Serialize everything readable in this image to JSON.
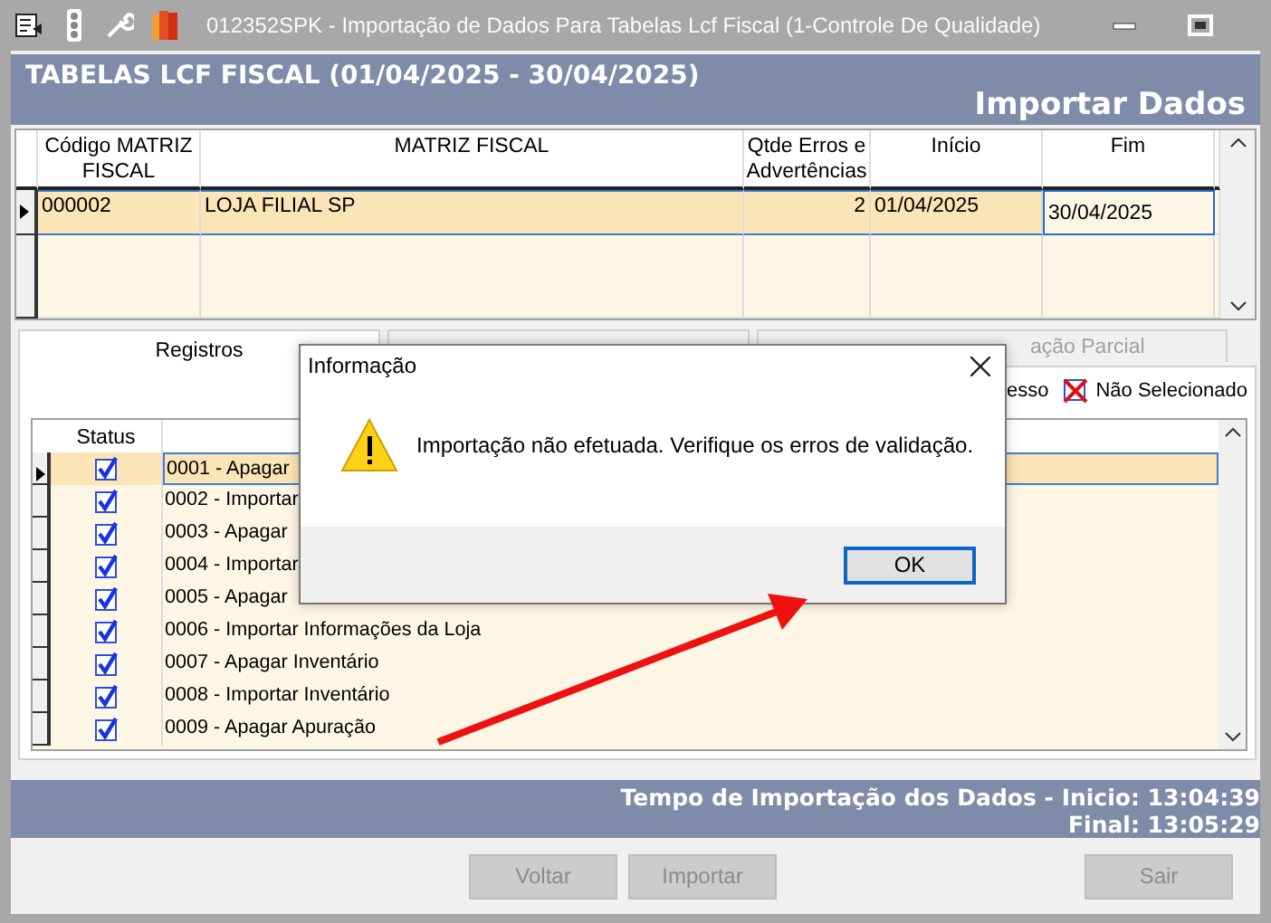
{
  "window": {
    "title": "012352SPK - Importação de Dados Para Tabelas Lcf Fiscal (1-Controle De Qualidade)"
  },
  "header": {
    "title": "TABELAS LCF FISCAL (01/04/2025 - 30/04/2025)",
    "subtitle": "Importar Dados"
  },
  "matrix_table": {
    "columns": [
      "Código MATRIZ FISCAL",
      "MATRIZ FISCAL",
      "Qtde Erros e Advertências",
      "Início",
      "Fim"
    ],
    "rows": [
      {
        "cells": [
          "000002",
          "LOJA FILIAL SP",
          "2",
          "01/04/2025",
          "30/04/2025"
        ],
        "selected": true
      }
    ]
  },
  "tabs": [
    {
      "label": "Registros",
      "selected": true
    },
    {
      "selected": false
    },
    {
      "label": "ação Parcial",
      "selected": false
    }
  ],
  "legend": [
    {
      "kind": "text",
      "label": "esso"
    },
    {
      "kind": "unselected",
      "label": "Não Selecionado"
    }
  ],
  "steps_table": {
    "columns": [
      "Status"
    ],
    "rows": [
      {
        "label": "0001 - Apagar",
        "checked": true,
        "selected": true
      },
      {
        "label": "0002 - Importar",
        "checked": true,
        "selected": false
      },
      {
        "label": "0003 - Apagar",
        "checked": true,
        "selected": false
      },
      {
        "label": "0004 - Importar",
        "checked": true,
        "selected": false
      },
      {
        "label": "0005 - Apagar",
        "checked": true,
        "selected": false
      },
      {
        "label": "0006 - Importar Informações da Loja",
        "checked": true,
        "selected": false
      },
      {
        "label": "0007 - Apagar Inventário",
        "checked": true,
        "selected": false
      },
      {
        "label": "0008 - Importar Inventário",
        "checked": true,
        "selected": false
      },
      {
        "label": "0009 - Apagar Apuração",
        "checked": true,
        "selected": false
      }
    ]
  },
  "dialog": {
    "title": "Informação",
    "message": "Importação não efetuada. Verifique os erros de validação.",
    "button": "OK"
  },
  "footer": {
    "start": "Tempo de Importação dos Dados - Inicio: 13:04:39",
    "end": "Final: 13:05:29"
  },
  "buttons": [
    {
      "label": "Voltar",
      "disabled": true
    },
    {
      "label": "Importar",
      "disabled": true
    },
    {
      "label": "Sair",
      "disabled": true
    }
  ]
}
